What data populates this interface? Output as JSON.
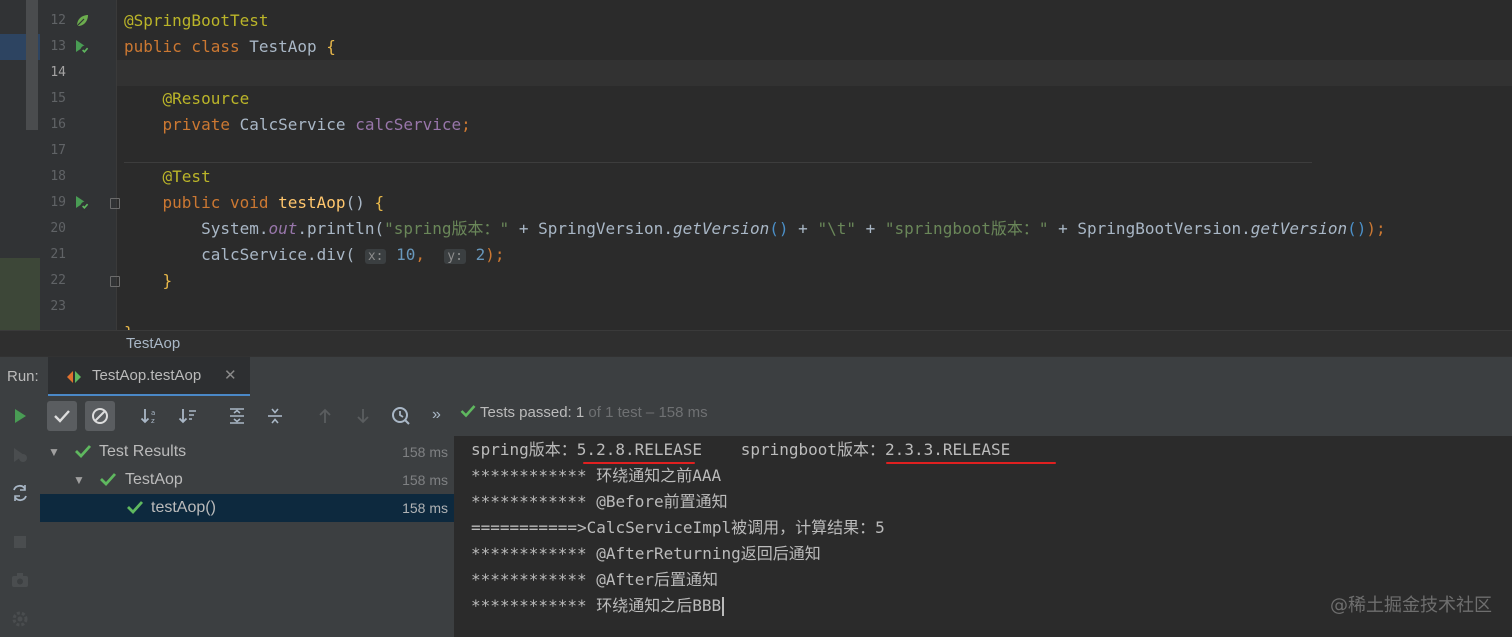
{
  "editor": {
    "lines": [
      {
        "num": "12",
        "parts": [
          {
            "t": "@SpringBootTest",
            "c": "#bbb529"
          }
        ]
      },
      {
        "num": "13",
        "parts": [
          {
            "t": "public class ",
            "c": "#cc7832"
          },
          {
            "t": "TestAop ",
            "c": "#a9b7c6"
          },
          {
            "t": "{",
            "c": "#e8b84a"
          }
        ]
      },
      {
        "num": "14",
        "parts": []
      },
      {
        "num": "15",
        "parts": [
          {
            "t": "    @Resource",
            "c": "#bbb529"
          }
        ]
      },
      {
        "num": "16",
        "parts": [
          {
            "t": "    private ",
            "c": "#cc7832"
          },
          {
            "t": "CalcService ",
            "c": "#a9b7c6"
          },
          {
            "t": "calcService",
            "c": "#9876aa"
          },
          {
            "t": ";",
            "c": "#cc7832"
          }
        ]
      },
      {
        "num": "17",
        "parts": []
      },
      {
        "num": "18",
        "parts": [
          {
            "t": "    @Test",
            "c": "#bbb529"
          }
        ]
      },
      {
        "num": "19",
        "parts": [
          {
            "t": "    public void ",
            "c": "#cc7832"
          },
          {
            "t": "testAop",
            "c": "#ffc66d"
          },
          {
            "t": "() ",
            "c": "#a9b7c6"
          },
          {
            "t": "{",
            "c": "#e8b84a"
          }
        ]
      },
      {
        "num": "20",
        "parts": [
          {
            "t": "        System.",
            "c": "#a9b7c6"
          },
          {
            "t": "out",
            "c": "#9876aa",
            "i": true
          },
          {
            "t": ".println(",
            "c": "#a9b7c6"
          },
          {
            "t": "\"spring版本：\"",
            "c": "#6a8759"
          },
          {
            "t": " + SpringVersion.",
            "c": "#a9b7c6"
          },
          {
            "t": "getVersion",
            "c": "#a9b7c6",
            "i": true
          },
          {
            "t": "()",
            "c": "#4b8fc7"
          },
          {
            "t": " + ",
            "c": "#a9b7c6"
          },
          {
            "t": "\"\\t\"",
            "c": "#6a8759"
          },
          {
            "t": " + ",
            "c": "#a9b7c6"
          },
          {
            "t": "\"springboot版本：\"",
            "c": "#6a8759"
          },
          {
            "t": " + SpringBootVersion.",
            "c": "#a9b7c6"
          },
          {
            "t": "getVersion",
            "c": "#a9b7c6",
            "i": true
          },
          {
            "t": "()",
            "c": "#4b8fc7"
          },
          {
            "t": ");",
            "c": "#cc7832"
          }
        ]
      },
      {
        "num": "21",
        "parts": [
          {
            "t": "        calcService.div( ",
            "c": "#a9b7c6"
          },
          {
            "t": "x:",
            "c": "#8c8c8c",
            "h": true
          },
          {
            "t": " 10",
            "c": "#6897bb"
          },
          {
            "t": ",  ",
            "c": "#cc7832"
          },
          {
            "t": "y:",
            "c": "#8c8c8c",
            "h": true
          },
          {
            "t": " 2",
            "c": "#6897bb"
          },
          {
            "t": ");",
            "c": "#cc7832"
          }
        ]
      },
      {
        "num": "22",
        "parts": [
          {
            "t": "    }",
            "c": "#e8b84a"
          }
        ]
      },
      {
        "num": "23",
        "parts": []
      },
      {
        "num": "",
        "parts": [
          {
            "t": "}",
            "c": "#e8b84a"
          }
        ]
      }
    ],
    "current_line": "14",
    "breadcrumb": "TestAop"
  },
  "run": {
    "label": "Run:",
    "tab_label": "TestAop.testAop",
    "close_glyph": "✕",
    "status_passed": "Tests passed: 1",
    "status_detail": " of 1 test – 158 ms",
    "more_glyph": "»"
  },
  "tree": [
    {
      "name": "Test Results",
      "time": "158 ms"
    },
    {
      "name": "TestAop",
      "time": "158 ms"
    },
    {
      "name": "testAop()",
      "time": "158 ms"
    }
  ],
  "console": [
    "spring版本：5.2.8.RELEASE\tspringboot版本：2.3.3.RELEASE",
    "************ 环绕通知之前AAA",
    "************ @Before前置通知",
    "===========>CalcServiceImpl被调用，计算结果：5",
    "************ @AfterReturning返回后通知",
    "************ @After后置通知",
    "************ 环绕通知之后BBB"
  ],
  "watermark": "@稀土掘金技术社区",
  "colors": {
    "pass_green": "#5fb85f",
    "run_green": "#499c54",
    "selection": "#0d293e",
    "underline_red": "#e02020"
  }
}
